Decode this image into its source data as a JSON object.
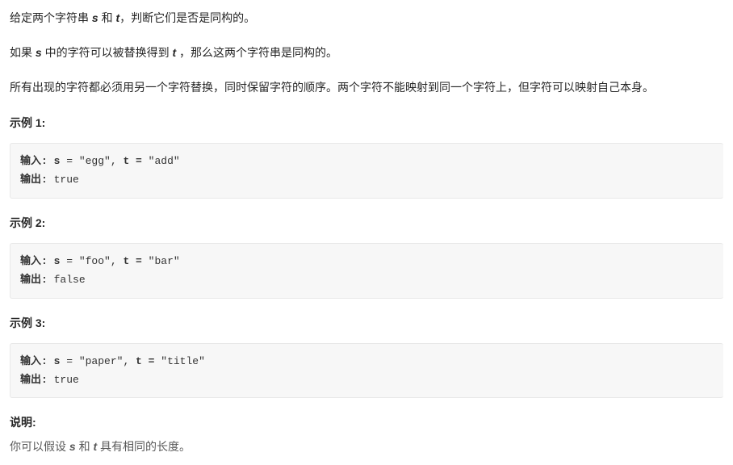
{
  "intro": {
    "p1_a": "给定两个字符串 ",
    "p1_s": "s",
    "p1_b": " 和 ",
    "p1_t": "t",
    "p1_c": "，判断它们是否是同构的。",
    "p2_a": "如果 ",
    "p2_s": "s",
    "p2_b": " 中的字符可以被替换得到 ",
    "p2_t": "t",
    "p2_c": " ，那么这两个字符串是同构的。",
    "p3": "所有出现的字符都必须用另一个字符替换，同时保留字符的顺序。两个字符不能映射到同一个字符上，但字符可以映射自己本身。"
  },
  "examples": {
    "label1": "示例 1:",
    "label2": "示例 2:",
    "label3": "示例 3:",
    "input_label": "输入: ",
    "output_label": "输出: ",
    "s_var": "s",
    "t_var": "t =",
    "eq": " = ",
    "comma": ", ",
    "ex1": {
      "s_val": "\"egg\"",
      "t_val": "\"add\"",
      "out": "true"
    },
    "ex2": {
      "s_val": "\"foo\"",
      "t_val": "\"bar\"",
      "out": "false"
    },
    "ex3": {
      "s_val": "\"paper\"",
      "t_val": "\"title\"",
      "out": "true"
    }
  },
  "note": {
    "heading": "说明:",
    "a": "你可以假设 ",
    "s": "s",
    "b": " 和 ",
    "t": "t",
    "c": " 具有相同的长度。"
  }
}
